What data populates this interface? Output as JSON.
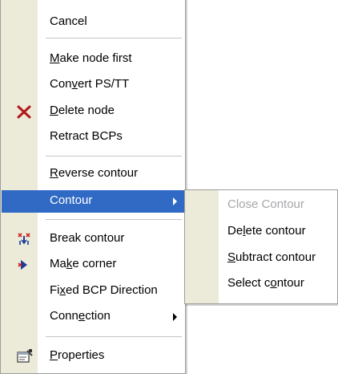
{
  "main_menu": {
    "items": [
      {
        "pre": "Cancel",
        "key": "",
        "post": ""
      },
      {
        "pre": "",
        "key": "M",
        "post": "ake node first"
      },
      {
        "pre": "Con",
        "key": "v",
        "post": "ert PS/TT"
      },
      {
        "pre": "",
        "key": "D",
        "post": "elete node",
        "icon": "red-x-delete-icon"
      },
      {
        "pre": "Retract BCPs",
        "key": "",
        "post": ""
      },
      {
        "pre": "",
        "key": "R",
        "post": "everse contour"
      },
      {
        "pre": "Contour",
        "key": "",
        "post": "",
        "submenu": true,
        "highlighted": true
      },
      {
        "pre": "Break contour",
        "key": "",
        "post": "",
        "icon": "break-contour-icon"
      },
      {
        "pre": "Ma",
        "key": "k",
        "post": "e corner",
        "icon": "make-corner-icon"
      },
      {
        "pre": "Fi",
        "key": "x",
        "post": "ed BCP Direction"
      },
      {
        "pre": "Conn",
        "key": "e",
        "post": "ction",
        "submenu": true
      },
      {
        "pre": "",
        "key": "P",
        "post": "roperties",
        "icon": "properties-icon"
      }
    ]
  },
  "contour_submenu": {
    "items": [
      {
        "pre": "Close Contour",
        "key": "",
        "post": "",
        "disabled": true
      },
      {
        "pre": "De",
        "key": "l",
        "post": "ete contour"
      },
      {
        "pre": "",
        "key": "S",
        "post": "ubtract contour"
      },
      {
        "pre": "Select c",
        "key": "o",
        "post": "ntour"
      }
    ]
  },
  "colors": {
    "highlight": "#316ac5",
    "gutter": "#ecead8",
    "delete_icon": "#b4161c",
    "disabled_text": "#a7a6aa"
  }
}
